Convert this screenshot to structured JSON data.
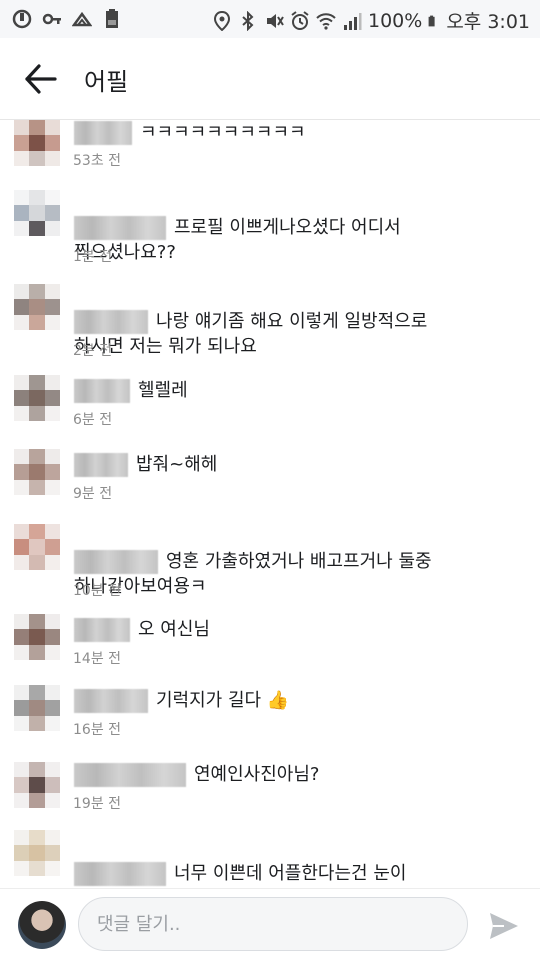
{
  "status_bar": {
    "battery": "100%",
    "time": "오후 3:01",
    "icons": [
      "app-icon",
      "key-icon",
      "upload-icon",
      "battery-saver-icon",
      "location-icon",
      "bluetooth-icon",
      "mute-icon",
      "alarm-icon",
      "wifi-icon",
      "signal-icon",
      "battery-icon"
    ]
  },
  "header": {
    "title": "어필",
    "back_icon": "arrow-left-icon"
  },
  "comments": [
    {
      "text": "ㅋㅋㅋㅋㅋㅋㅋㅋㅋㅋ",
      "time": "53초 전"
    },
    {
      "text": "프로필 이쁘게나오셨다 어디서\n찍으셨나요??",
      "time": "1분 전"
    },
    {
      "text": "나랑 얘기좀 해요 이렇게 일방적으로\n하시면 저는 뭐가 되나요",
      "time": "2분 전"
    },
    {
      "text": "헬렐레",
      "time": "6분 전"
    },
    {
      "text": "밥줘~해헤",
      "time": "9분 전"
    },
    {
      "text": "영혼 가출하였거나 배고프거나 둘중\n하나같아보여용ㅋ",
      "time": "10분 전"
    },
    {
      "text": "오 여신님",
      "time": "14분 전"
    },
    {
      "text": "기럭지가 길다 👍",
      "time": "16분 전"
    },
    {
      "text": "연예인사진아님?",
      "time": "19분 전"
    },
    {
      "text": "너무 이쁜데 어플한다는건 눈이\n높다는건가요.",
      "time": ""
    }
  ],
  "composer": {
    "placeholder": "댓글 달기..",
    "send_icon": "send-icon"
  },
  "colors": {
    "status_bar_bg": "#f6f7f9",
    "text": "#1c1e21",
    "timestamp": "#8d8d8d",
    "send_icon": "#bcc0c4"
  }
}
